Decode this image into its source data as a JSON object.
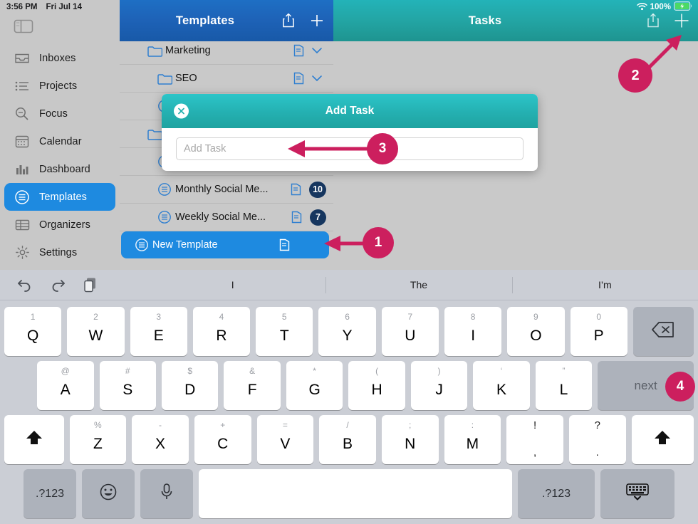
{
  "status_bar": {
    "time": "3:56 PM",
    "date": "Fri Jul 14",
    "battery_percent": "100%",
    "wifi_icon": "wifi-icon",
    "battery_icon": "battery-charging-icon"
  },
  "sidebar": {
    "toggle_icon": "sidebar-toggle-icon",
    "items": [
      {
        "label": "Inboxes",
        "icon": "inbox-icon",
        "active": false
      },
      {
        "label": "Projects",
        "icon": "list-icon",
        "active": false
      },
      {
        "label": "Focus",
        "icon": "search-icon",
        "active": false
      },
      {
        "label": "Calendar",
        "icon": "calendar-icon",
        "active": false
      },
      {
        "label": "Dashboard",
        "icon": "bar-chart-icon",
        "active": false
      },
      {
        "label": "Templates",
        "icon": "template-icon",
        "active": true
      },
      {
        "label": "Organizers",
        "icon": "table-icon",
        "active": false
      },
      {
        "label": "Settings",
        "icon": "gear-icon",
        "active": false
      }
    ]
  },
  "templates_panel": {
    "title": "Templates",
    "share_icon": "share-icon",
    "add_icon": "plus-icon",
    "rows": [
      {
        "name": "Marketing",
        "type": "folder",
        "trailing": "chevron",
        "badge": ""
      },
      {
        "name": "SEO",
        "type": "folder",
        "trailing": "chevron",
        "badge": ""
      },
      {
        "name": "",
        "type": "template",
        "trailing": "",
        "badge": ""
      },
      {
        "name": "",
        "type": "folder",
        "trailing": "",
        "badge": ""
      },
      {
        "name": "",
        "type": "template",
        "trailing": "",
        "badge": ""
      },
      {
        "name": "Monthly Social Me...",
        "type": "template",
        "trailing": "badge",
        "badge": "10"
      },
      {
        "name": "Weekly Social Me...",
        "type": "template",
        "trailing": "badge",
        "badge": "7"
      },
      {
        "name": "New Template",
        "type": "template",
        "trailing": "doc",
        "badge": "",
        "selected": true
      }
    ]
  },
  "tasks_panel": {
    "title": "Tasks",
    "share_icon": "share-icon",
    "add_icon": "plus-icon"
  },
  "modal": {
    "title": "Add Task",
    "close_icon": "close-icon",
    "input_placeholder": "Add Task",
    "input_value": ""
  },
  "keyboard": {
    "predictive": {
      "undo_icon": "undo-icon",
      "redo_icon": "redo-icon",
      "paste_icon": "paste-icon",
      "suggestions": [
        "I",
        "The",
        "I’m"
      ]
    },
    "row1": [
      {
        "main": "Q",
        "alt": "1"
      },
      {
        "main": "W",
        "alt": "2"
      },
      {
        "main": "E",
        "alt": "3"
      },
      {
        "main": "R",
        "alt": "4"
      },
      {
        "main": "T",
        "alt": "5"
      },
      {
        "main": "Y",
        "alt": "6"
      },
      {
        "main": "U",
        "alt": "7"
      },
      {
        "main": "I",
        "alt": "8"
      },
      {
        "main": "O",
        "alt": "9"
      },
      {
        "main": "P",
        "alt": "0"
      }
    ],
    "row1_delete": {
      "icon": "backspace-icon"
    },
    "row2": [
      {
        "main": "A",
        "alt": "@"
      },
      {
        "main": "S",
        "alt": "#"
      },
      {
        "main": "D",
        "alt": "$"
      },
      {
        "main": "F",
        "alt": "&"
      },
      {
        "main": "G",
        "alt": "*"
      },
      {
        "main": "H",
        "alt": "("
      },
      {
        "main": "J",
        "alt": ")"
      },
      {
        "main": "K",
        "alt": "‘"
      },
      {
        "main": "L",
        "alt": "”"
      }
    ],
    "row2_next": {
      "label": "next"
    },
    "row3_shift_left": {
      "icon": "shift-icon"
    },
    "row3": [
      {
        "main": "Z",
        "alt": "%"
      },
      {
        "main": "X",
        "alt": "-"
      },
      {
        "main": "C",
        "alt": "+"
      },
      {
        "main": "V",
        "alt": "="
      },
      {
        "main": "B",
        "alt": "/"
      },
      {
        "main": "N",
        "alt": ";"
      },
      {
        "main": "M",
        "alt": ":"
      }
    ],
    "row3_punct": [
      {
        "top": "!",
        "bottom": ","
      },
      {
        "top": "?",
        "bottom": "."
      }
    ],
    "row3_shift_right": {
      "icon": "shift-icon"
    },
    "row4": {
      "numbers_left": ".?123",
      "emoji_icon": "emoji-icon",
      "mic_icon": "microphone-icon",
      "space": "",
      "numbers_right": ".?123",
      "dismiss_icon": "keyboard-dismiss-icon"
    }
  },
  "annotations": {
    "color": "#cc1f5e",
    "markers": [
      {
        "number": "1",
        "points_to": "new-template-row"
      },
      {
        "number": "2",
        "points_to": "tasks-add-button"
      },
      {
        "number": "3",
        "points_to": "add-task-input"
      },
      {
        "number": "4",
        "points_to": "keyboard-next-key"
      }
    ]
  }
}
